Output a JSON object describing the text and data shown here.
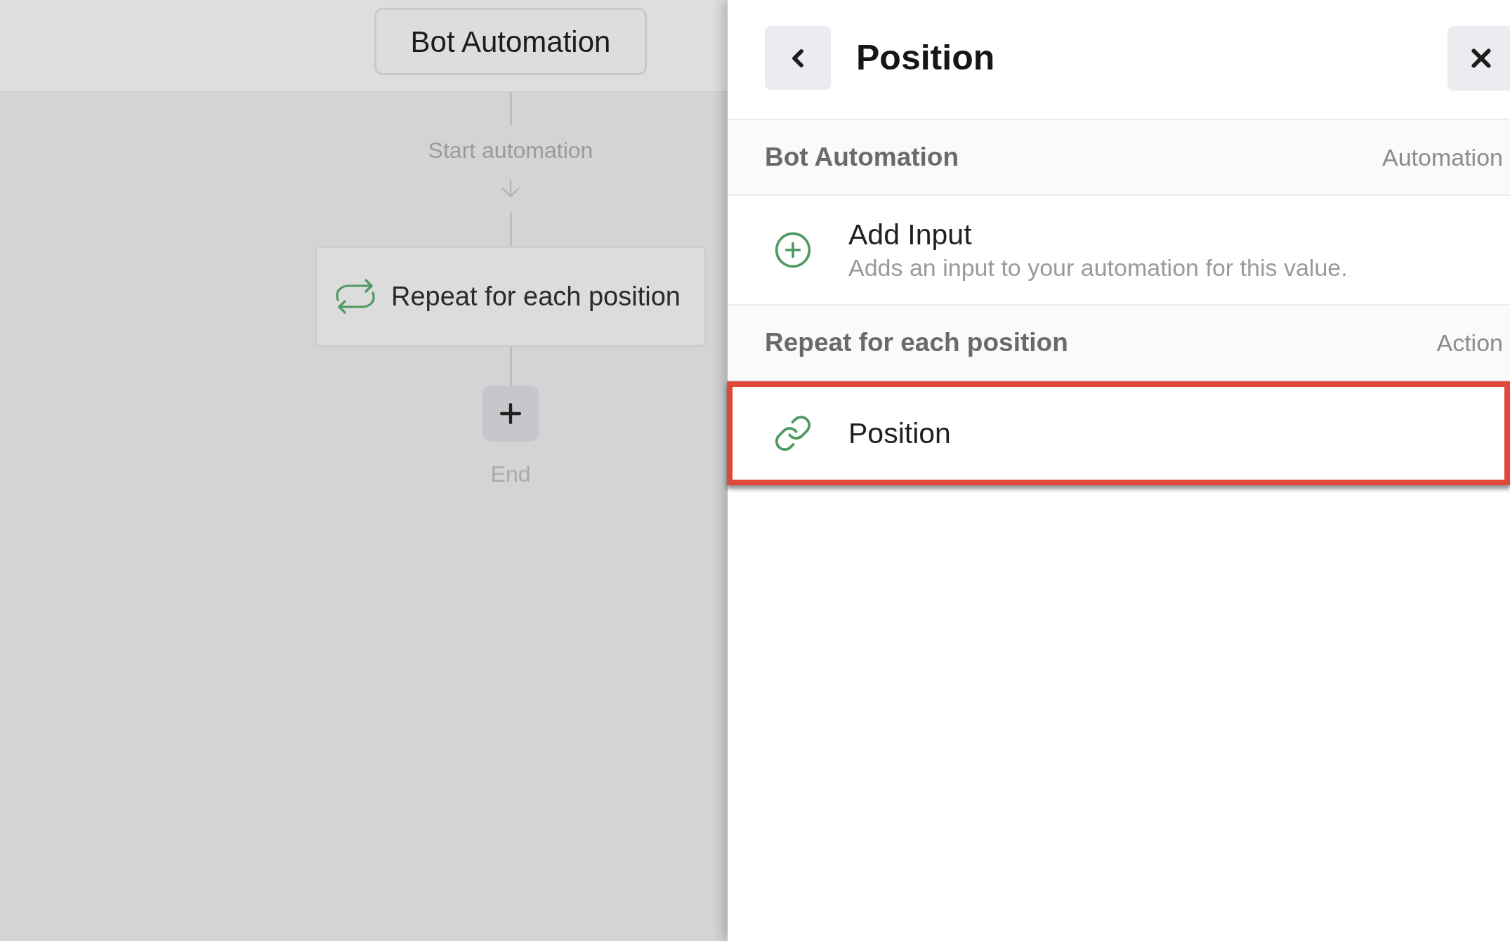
{
  "canvas": {
    "trigger_button": "Bot Automation",
    "start_label": "Start automation",
    "steps": [
      {
        "kind": "repeat",
        "label": "Repeat for each position"
      }
    ],
    "end_label": "End"
  },
  "panel": {
    "title": "Position",
    "sections": [
      {
        "title": "Bot Automation",
        "type_label": "Automation",
        "items": [
          {
            "kind": "add_input",
            "title": "Add Input",
            "description": "Adds an input to your automation for this value.",
            "highlighted": false
          }
        ]
      },
      {
        "title": "Repeat for each position",
        "type_label": "Action",
        "items": [
          {
            "kind": "variable",
            "title": "Position",
            "highlighted": true
          }
        ]
      }
    ]
  }
}
